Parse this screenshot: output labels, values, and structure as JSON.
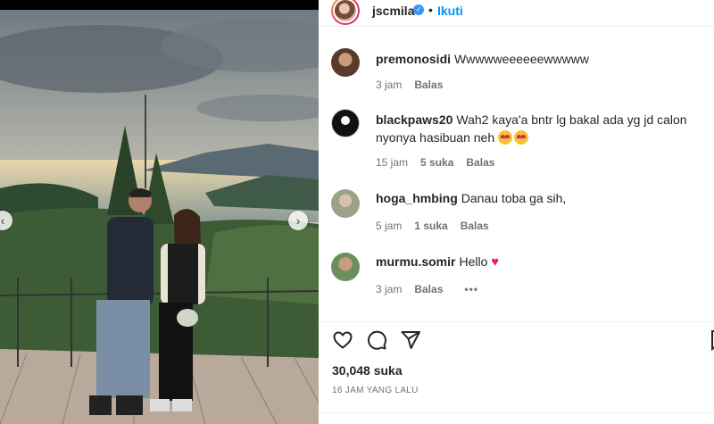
{
  "post": {
    "username": "jscmila",
    "follow_label": "Ikuti",
    "dot": "•",
    "verified_glyph": "✓",
    "likes": "30,048 suka",
    "time_ago": "16 JAM YANG LALU"
  },
  "comments": [
    {
      "username": "premonosidi",
      "text": "Wwwwweeeeeewwwww",
      "time": "3 jam",
      "likes": "",
      "reply": "Balas"
    },
    {
      "username": "blackpaws20",
      "text": "Wah2 kaya'a bntr lg bakal ada yg jd calon nyonya hasibuan neh",
      "time": "15 jam",
      "likes": "5 suka",
      "reply": "Balas"
    },
    {
      "username": "hoga_hmbing",
      "text": "Danau toba ga sih,",
      "time": "5 jam",
      "likes": "1 suka",
      "reply": "Balas"
    },
    {
      "username": "murmu.somir",
      "text": "Hello",
      "time": "3 jam",
      "likes": "",
      "reply": "Balas",
      "more": "•••"
    }
  ],
  "icons": {
    "heart": "♥",
    "prev": "‹",
    "next": "›"
  },
  "colors": {
    "accent": "#0095f6",
    "meta": "#737373",
    "heart": "#e0245e"
  }
}
